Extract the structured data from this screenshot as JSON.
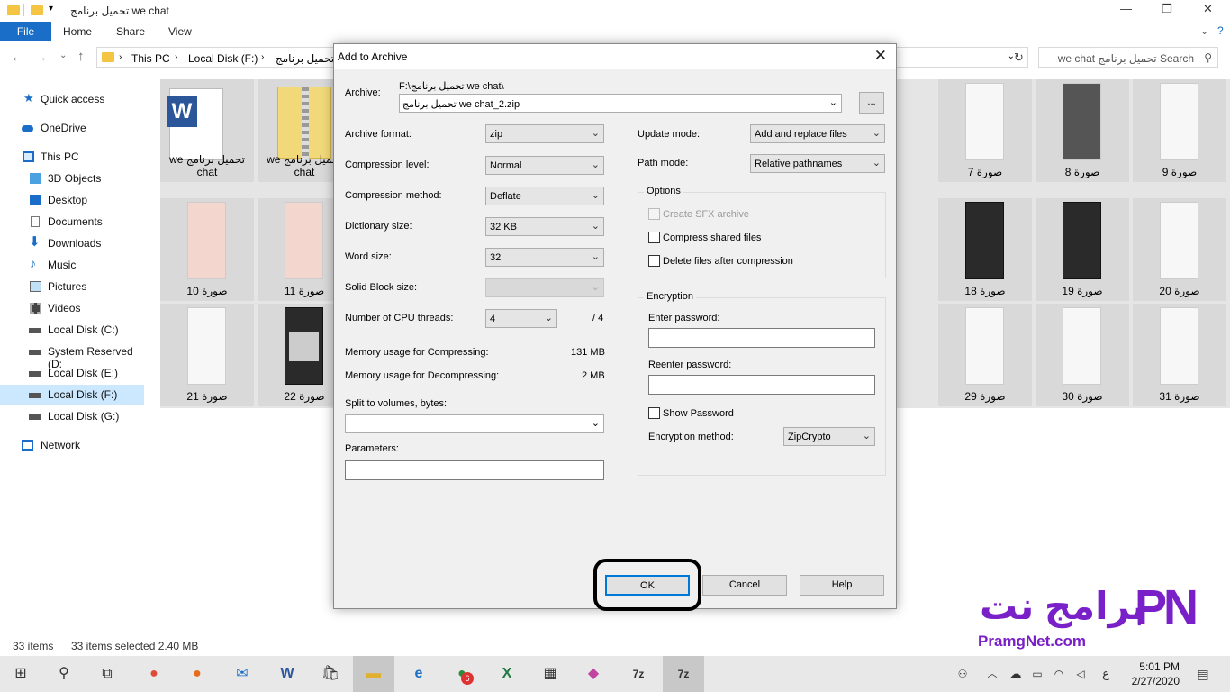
{
  "explorer": {
    "title": "تحميل برنامج we chat",
    "ribbon_tabs": [
      "File",
      "Home",
      "Share",
      "View"
    ],
    "address": [
      "This PC",
      "Local Disk (F:)",
      "تحميل برنامج"
    ],
    "search_placeholder": "Search تحميل برنامج we chat"
  },
  "sidebar": {
    "items": [
      {
        "label": "Quick access",
        "icon": "star-icon"
      },
      {
        "label": "OneDrive",
        "icon": "cloud-icon"
      },
      {
        "label": "This PC",
        "icon": "computer-icon"
      },
      {
        "label": "3D Objects",
        "icon": "cube-icon"
      },
      {
        "label": "Desktop",
        "icon": "desktop-icon"
      },
      {
        "label": "Documents",
        "icon": "document-icon"
      },
      {
        "label": "Downloads",
        "icon": "download-icon"
      },
      {
        "label": "Music",
        "icon": "music-icon"
      },
      {
        "label": "Pictures",
        "icon": "pictures-icon"
      },
      {
        "label": "Videos",
        "icon": "video-icon"
      },
      {
        "label": "Local Disk (C:)",
        "icon": "drive-icon"
      },
      {
        "label": "System Reserved (D:",
        "icon": "drive-icon"
      },
      {
        "label": "Local Disk (E:)",
        "icon": "drive-icon"
      },
      {
        "label": "Local Disk (F:)",
        "icon": "drive-icon"
      },
      {
        "label": "Local Disk (G:)",
        "icon": "drive-icon"
      },
      {
        "label": "Network",
        "icon": "network-icon"
      }
    ]
  },
  "files": {
    "row1": [
      "تحميل برنامج we chat",
      "تحميل برنامج we chat",
      "صورة 7",
      "صورة 8",
      "صورة 9"
    ],
    "row2": [
      "صورة 10",
      "صورة 11",
      "صورة 18",
      "صورة 19",
      "صورة 20"
    ],
    "row3": [
      "صورة 21",
      "صورة 22",
      "صورة 29",
      "صورة 30",
      "صورة 31"
    ]
  },
  "status": {
    "count": "33 items",
    "selected": "33 items selected  2.40 MB"
  },
  "dialog": {
    "title": "Add to Archive",
    "archive_label": "Archive:",
    "archive_path": "F:\\تحميل برنامج we chat\\",
    "archive_name": "تحميل برنامج we chat_2.zip",
    "browse": "...",
    "format_label": "Archive format:",
    "format": "zip",
    "level_label": "Compression level:",
    "level": "Normal",
    "method_label": "Compression method:",
    "method": "Deflate",
    "dict_label": "Dictionary size:",
    "dict": "32 KB",
    "word_label": "Word size:",
    "word": "32",
    "solid_label": "Solid Block size:",
    "threads_label": "Number of CPU threads:",
    "threads": "4",
    "threads_total": "/ 4",
    "mem_comp_label": "Memory usage for Compressing:",
    "mem_comp": "131 MB",
    "mem_decomp_label": "Memory usage for Decompressing:",
    "mem_decomp": "2 MB",
    "split_label": "Split to volumes, bytes:",
    "params_label": "Parameters:",
    "update_label": "Update mode:",
    "update": "Add and replace files",
    "pathmode_label": "Path mode:",
    "pathmode": "Relative pathnames",
    "options_label": "Options",
    "opt_sfx": "Create SFX archive",
    "opt_shared": "Compress shared files",
    "opt_delete": "Delete files after compression",
    "enc_label": "Encryption",
    "enter_pw": "Enter password:",
    "reenter_pw": "Reenter password:",
    "show_pw": "Show Password",
    "enc_method_label": "Encryption method:",
    "enc_method": "ZipCrypto",
    "ok": "OK",
    "cancel": "Cancel",
    "help": "Help"
  },
  "watermark": {
    "arabic": "برامج نت",
    "english": "PramgNet.com",
    "logo": "PN"
  },
  "taskbar": {
    "time": "5:01 PM",
    "date": "2/27/2020",
    "lang": "ع",
    "badge": "6"
  },
  "colors": {
    "accent": "#1a6ec7",
    "brand": "#7a20c8",
    "selected": "#cce8ff"
  }
}
